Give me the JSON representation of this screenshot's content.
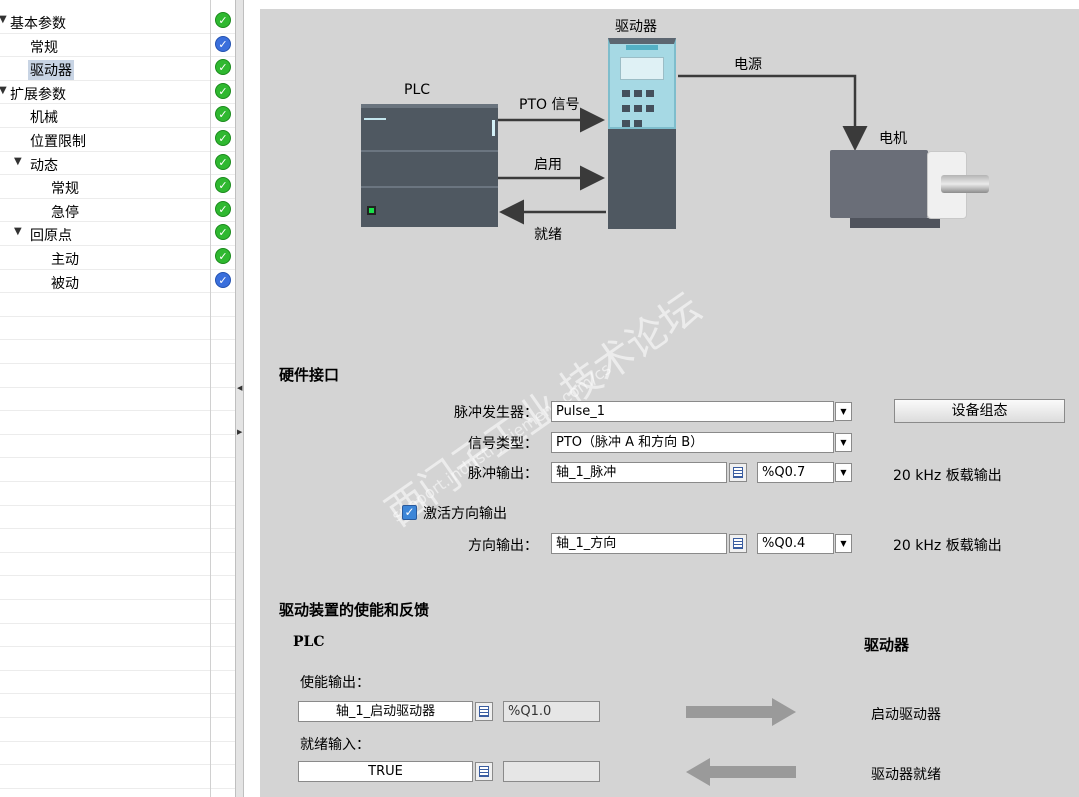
{
  "tree": {
    "items": [
      {
        "label": "基本参数",
        "level": 0,
        "expanded": true,
        "status": "ok"
      },
      {
        "label": "常规",
        "level": 1,
        "status": "info"
      },
      {
        "label": "驱动器",
        "level": 1,
        "status": "ok",
        "selected": true
      },
      {
        "label": "扩展参数",
        "level": 0,
        "expanded": true,
        "status": "ok"
      },
      {
        "label": "机械",
        "level": 1,
        "status": "ok"
      },
      {
        "label": "位置限制",
        "level": 1,
        "status": "ok"
      },
      {
        "label": "动态",
        "level": 1,
        "expanded": true,
        "status": "ok"
      },
      {
        "label": "常规",
        "level": 2,
        "status": "ok"
      },
      {
        "label": "急停",
        "level": 2,
        "status": "ok"
      },
      {
        "label": "回原点",
        "level": 1,
        "expanded": true,
        "status": "ok"
      },
      {
        "label": "主动",
        "level": 2,
        "status": "ok"
      },
      {
        "label": "被动",
        "level": 2,
        "status": "info"
      }
    ]
  },
  "diagram": {
    "drive_label": "驱动器",
    "plc_label": "PLC",
    "power_label": "电源",
    "motor_label": "电机",
    "pto_label": "PTO 信号",
    "enable_label": "启用",
    "ready_label": "就绪"
  },
  "hardware": {
    "title": "硬件接口",
    "pulse_gen_label": "脉冲发生器：",
    "pulse_gen_value": "Pulse_1",
    "config_button": "设备组态",
    "signal_type_label": "信号类型：",
    "signal_type_value": "PTO（脉冲 A 和方向 B）",
    "pulse_out_label": "脉冲输出：",
    "pulse_out_value": "轴_1_脉冲",
    "pulse_out_addr": "%Q0.7",
    "pulse_out_note": "20 kHz 板载输出",
    "activate_dir_label": "激活方向输出",
    "activate_dir_checked": true,
    "dir_out_label": "方向输出：",
    "dir_out_value": "轴_1_方向",
    "dir_out_addr": "%Q0.4",
    "dir_out_note": "20 kHz 板载输出"
  },
  "feedback": {
    "title": "驱动装置的使能和反馈",
    "plc_header": "PLC",
    "drive_header": "驱动器",
    "enable_out_label": "使能输出：",
    "enable_out_value": "轴_1_启动驱动器",
    "enable_out_addr": "%Q1.0",
    "enable_target": "启动驱动器",
    "ready_in_label": "就绪输入：",
    "ready_in_value": "TRUE",
    "ready_in_addr": "",
    "ready_source": "驱动器就绪"
  },
  "watermark": {
    "main": "西门子工业 技术论坛",
    "url": "support.industry.siemens.com/cs"
  },
  "colors": {
    "status_ok": "#2fb830",
    "status_info": "#3a6fdc",
    "drive_accent": "#a6d9e4",
    "plc_body": "#4f5861"
  }
}
